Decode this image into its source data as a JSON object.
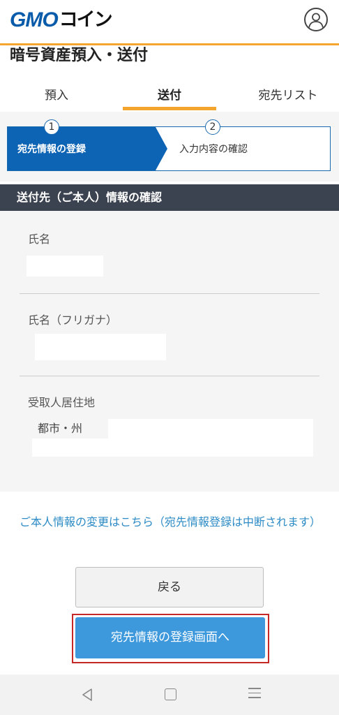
{
  "header": {
    "logo_gmo": "GMO",
    "logo_coin": "コイン",
    "account_icon": "user-circle-icon"
  },
  "page_title": "暗号資産預入・送付",
  "tabs": [
    {
      "label": "預入",
      "active": false
    },
    {
      "label": "送付",
      "active": true
    },
    {
      "label": "宛先リスト",
      "active": false
    }
  ],
  "steps": [
    {
      "number": "1",
      "label": "宛先情報の登録",
      "active": true
    },
    {
      "number": "2",
      "label": "入力内容の確認",
      "active": false
    }
  ],
  "section_title": "送付先（ご本人）情報の確認",
  "fields": {
    "name_label": "氏名",
    "furigana_label": "氏名（フリガナ）",
    "address_label": "受取人居住地",
    "address_prefix": "都市・州"
  },
  "change_link": "ご本人情報の変更はこちら（宛先情報登録は中断されます）",
  "buttons": {
    "back": "戻る",
    "register": "宛先情報の登録画面へ"
  },
  "navbar": {
    "back_icon": "triangle-back-icon",
    "home_icon": "square-home-icon",
    "recent_icon": "menu-lines-icon"
  },
  "colors": {
    "accent_orange": "#f3a52d",
    "brand_blue": "#0a5cab",
    "step_active": "#0d63b4",
    "section_header": "#3c4350",
    "primary_button": "#3d98dc",
    "link": "#2d8bc5",
    "highlight": "#c62828"
  }
}
